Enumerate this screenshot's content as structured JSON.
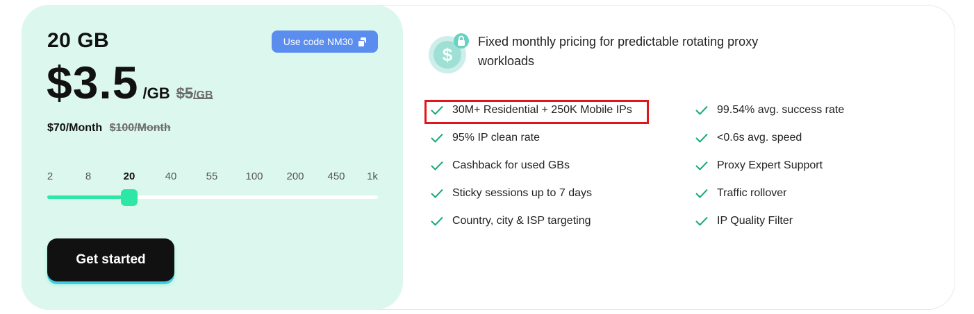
{
  "plan": {
    "size_label": "20 GB",
    "promo_label": "Use code NM30",
    "price": "$3.5",
    "price_unit": "/GB",
    "old_price": "$5",
    "old_price_unit": "/GB",
    "monthly_price": "$70/Month",
    "old_monthly_price": "$100/Month"
  },
  "slider": {
    "ticks": [
      "2",
      "8",
      "20",
      "40",
      "55",
      "100",
      "200",
      "450",
      "1k"
    ],
    "selected_index": 2,
    "accent_color": "#2ee6a6"
  },
  "cta": {
    "label": "Get started"
  },
  "info": {
    "headline": "Fixed monthly pricing for predictable rotating proxy workloads",
    "icon": "money-lock-icon"
  },
  "features": {
    "left": [
      "30M+ Residential + 250K Mobile IPs",
      "95% IP clean rate",
      "Cashback for used GBs",
      "Sticky sessions up to 7 days",
      "Country, city & ISP targeting"
    ],
    "right": [
      "99.54% avg. success rate",
      "<0.6s avg. speed",
      "Proxy Expert Support",
      "Traffic rollover",
      "IP Quality Filter"
    ],
    "highlighted": "30M+ Residential + 250K Mobile IPs",
    "check_color": "#16a974",
    "highlight_color": "#e0161c"
  }
}
